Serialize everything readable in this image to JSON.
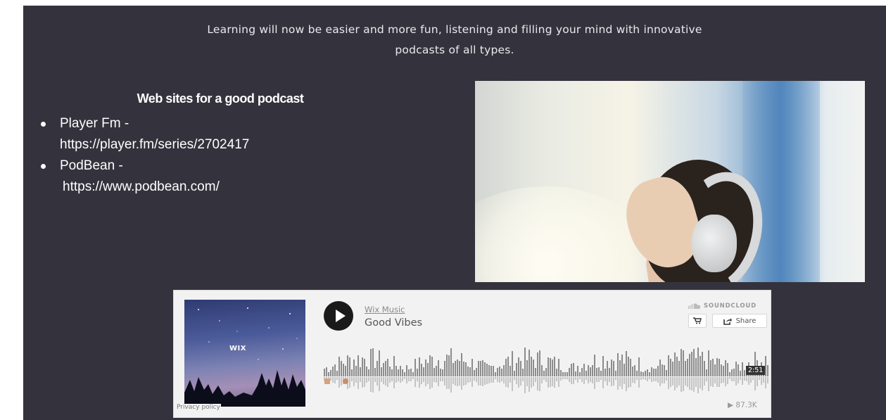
{
  "intro": {
    "line1": "Learning will now be easier and more fun, listening and filling your mind with innovative",
    "line2": "podcasts of all types."
  },
  "sites": {
    "heading": "Web sites for a good podcast",
    "items": [
      {
        "name": "Player Fm -",
        "url": "https://player.fm/series/2702417"
      },
      {
        "name": "PodBean -",
        "url": "https://www.podbean.com/"
      }
    ]
  },
  "photo": {
    "icon": "person-with-headphones-photo"
  },
  "player": {
    "artist": "Wix Music",
    "track": "Good Vibes",
    "brand": "SOUNDCLOUD",
    "share_label": "Share",
    "duration": "2:51",
    "plays": "87.3K",
    "privacy": "Privacy policy",
    "cover_text": "WIX",
    "progress": 0,
    "colors": {
      "wave": "#8c8c8c",
      "wave_reflection": "#c4c4c4",
      "accent": "#1a1a1a"
    }
  }
}
